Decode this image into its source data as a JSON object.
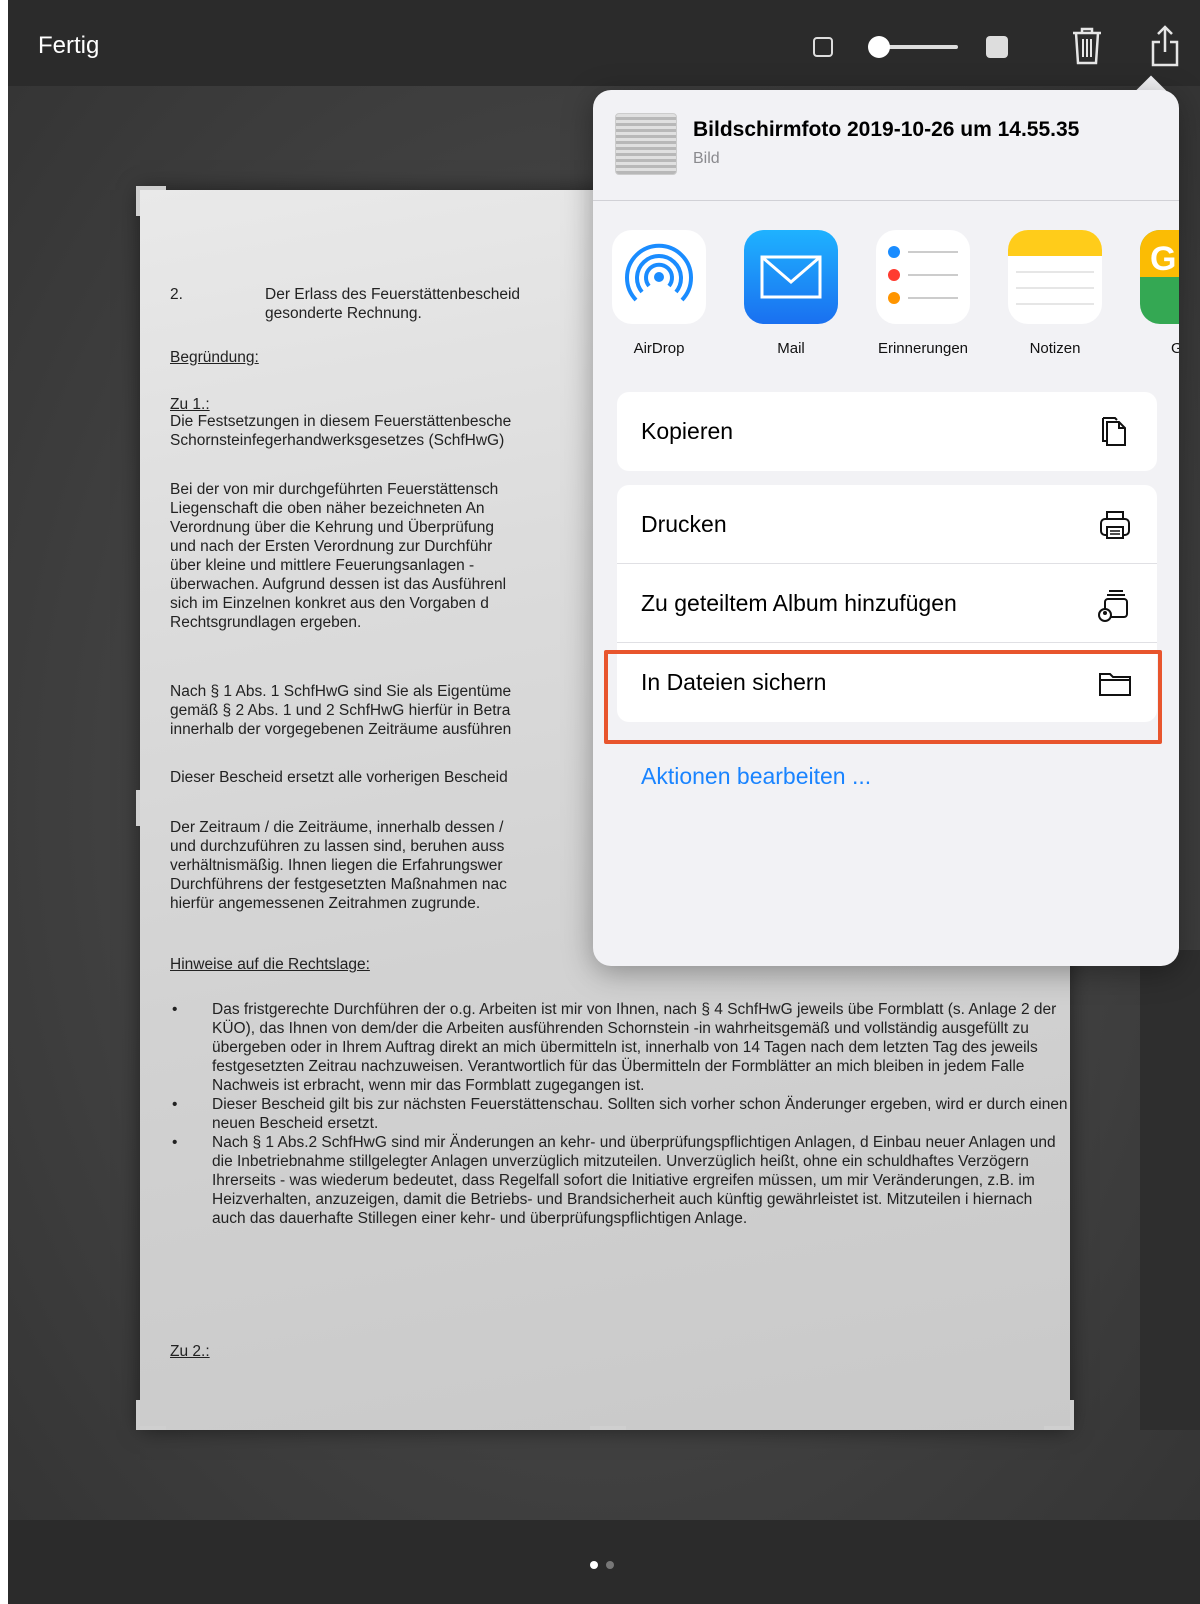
{
  "topbar": {
    "done_label": "Fertig"
  },
  "document": {
    "item2_num": "2.",
    "item2_text": "Der Erlass des Feuerstättenbescheid",
    "item2_text2": "gesonderte Rechnung.",
    "begruendung": "Begründung:",
    "zu1": "Zu 1.:",
    "para1": "Die Festsetzungen in diesem Feuerstättenbesche",
    "para1b": "Schornsteinfegerhandwerksgesetzes (SchfHwG)",
    "para2": [
      "Bei der von mir durchgeführten Feuerstättensch",
      "Liegenschaft die oben näher bezeichneten An",
      "Verordnung über die Kehrung und Überprüfung",
      "und nach der Ersten Verordnung zur Durchführ",
      "über kleine und mittlere Feuerungsanlagen -",
      "überwachen. Aufgrund dessen ist das Ausführenl",
      "sich im Einzelnen konkret aus den Vorgaben d",
      "Rechtsgrundlagen ergeben."
    ],
    "para3": [
      "Nach § 1 Abs. 1 SchfHwG sind Sie als Eigentüme",
      "gemäß § 2 Abs. 1 und 2 SchfHwG hierfür in Betra",
      "innerhalb der vorgegebenen Zeiträume ausführen"
    ],
    "para4": "Dieser Bescheid ersetzt alle vorherigen Bescheid",
    "para5": [
      "Der Zeitraum / die Zeiträume, innerhalb dessen /",
      "und durchzuführen zu lassen sind, beruhen auss",
      "verhältnismäßig. Ihnen liegen die Erfahrungswer",
      "Durchführens der festgesetzten Maßnahmen nac",
      "hierfür angemessenen Zeitrahmen zugrunde."
    ],
    "hinweise": "Hinweise auf die Rechtslage:",
    "bullets": [
      "Das fristgerechte Durchführen der o.g. Arbeiten ist mir von Ihnen, nach § 4 SchfHwG jeweils übe Formblatt (s. Anlage 2 der KÜO), das Ihnen von dem/der die Arbeiten ausführenden Schornstein -in wahrheitsgemäß und vollständig ausgefüllt zu übergeben oder in Ihrem Auftrag direkt an mich übermitteln ist, innerhalb von 14 Tagen nach dem letzten Tag des jeweils festgesetzten Zeitrau nachzuweisen. Verantwortlich für das Übermitteln der Formblätter an mich bleiben in jedem Falle Nachweis ist erbracht, wenn mir das Formblatt zugegangen ist.",
      "Dieser Bescheid gilt bis zur nächsten Feuerstättenschau. Sollten sich vorher schon Änderunger ergeben, wird er durch einen neuen Bescheid ersetzt.",
      "Nach § 1 Abs.2 SchfHwG sind mir Änderungen an kehr- und überprüfungspflichtigen Anlagen, d Einbau neuer Anlagen und die Inbetriebnahme stillgelegter Anlagen unverzüglich mitzuteilen. Unverzüglich heißt, ohne ein schuldhaftes Verzögern Ihrerseits - was wiederum bedeutet, dass Regelfall sofort die Initiative ergreifen müssen, um mir Veränderungen, z.B. im Heizverhalten, anzuzeigen, damit die Betriebs- und Brandsicherheit auch künftig gewährleistet ist. Mitzuteilen i hiernach auch das dauerhafte Stillegen einer kehr- und überprüfungspflichtigen Anlage."
    ],
    "zu2": "Zu 2.:"
  },
  "share_sheet": {
    "file_title": "Bildschirmfoto 2019-10-26 um 14.55.35",
    "file_type": "Bild",
    "apps": [
      {
        "label": "AirDrop",
        "icon": "airdrop-icon"
      },
      {
        "label": "Mail",
        "icon": "mail-icon"
      },
      {
        "label": "Erinnerungen",
        "icon": "reminders-icon"
      },
      {
        "label": "Notizen",
        "icon": "notes-icon"
      },
      {
        "label": "Goo",
        "icon": "google-maps-icon"
      }
    ],
    "actions_group1": [
      {
        "label": "Kopieren",
        "icon": "copy-icon"
      }
    ],
    "actions_group2": [
      {
        "label": "Drucken",
        "icon": "print-icon"
      },
      {
        "label": "Zu geteiltem Album hinzufügen",
        "icon": "shared-album-icon"
      },
      {
        "label": "In Dateien sichern",
        "icon": "folder-icon"
      }
    ],
    "edit_actions": "Aktionen bearbeiten ...",
    "highlight_color": "#e8552d"
  },
  "pager": {
    "pages": 2,
    "current": 1
  }
}
